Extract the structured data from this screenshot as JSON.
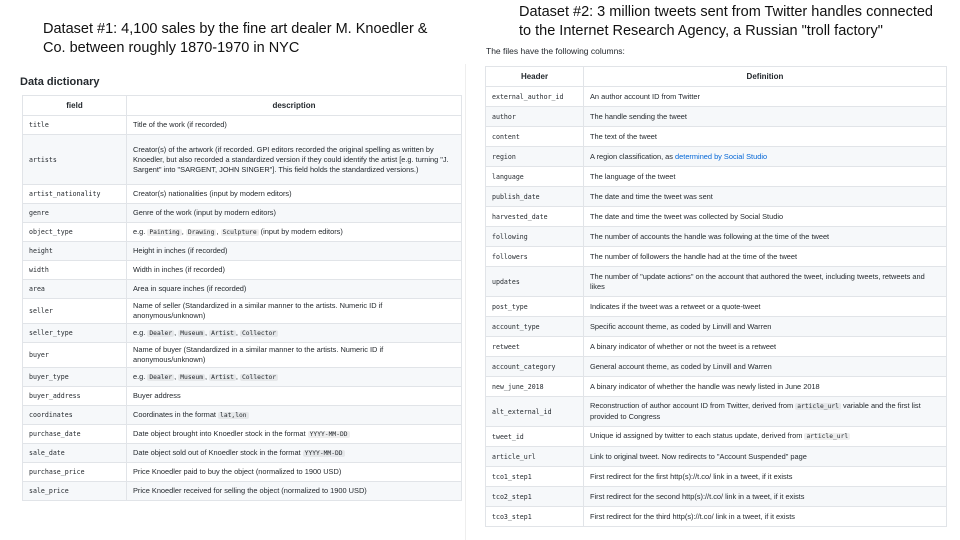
{
  "captions": {
    "dataset1": "Dataset #1: 4,100 sales by the fine art dealer M. Knoedler & Co. between roughly 1870-1970 in NYC",
    "dataset2": "Dataset #2: 3 million tweets sent from Twitter handles connected to the Internet Research Agency, a Russian \"troll factory\""
  },
  "left": {
    "heading": "Data dictionary",
    "columns": [
      "field",
      "description"
    ],
    "rows": [
      {
        "field": "title",
        "parts": [
          {
            "t": "Title of the work (if recorded)"
          }
        ]
      },
      {
        "field": "artists",
        "parts": [
          {
            "t": "Creator(s) of the artwork (if recorded. GPI editors recorded the original spelling as written by Knoedler, but also recorded a standardized version if they could identify the artist [e.g. turning \"J. Sargent\" into \"SARGENT, JOHN SINGER\"]. This field holds the standardized versions.)"
          }
        ]
      },
      {
        "field": "artist_nationality",
        "parts": [
          {
            "t": "Creator(s) nationalities (input by modern editors)"
          }
        ]
      },
      {
        "field": "genre",
        "parts": [
          {
            "t": "Genre of the work (input by modern editors)"
          }
        ]
      },
      {
        "field": "object_type",
        "parts": [
          {
            "t": "e.g. "
          },
          {
            "c": "Painting"
          },
          {
            "t": ", "
          },
          {
            "c": "Drawing"
          },
          {
            "t": ", "
          },
          {
            "c": "Sculpture"
          },
          {
            "t": " (input by modern editors)"
          }
        ]
      },
      {
        "field": "height",
        "parts": [
          {
            "t": "Height in inches (if recorded)"
          }
        ]
      },
      {
        "field": "width",
        "parts": [
          {
            "t": "Width in inches (if recorded)"
          }
        ]
      },
      {
        "field": "area",
        "parts": [
          {
            "t": "Area in square inches (if recorded)"
          }
        ]
      },
      {
        "field": "seller",
        "parts": [
          {
            "t": "Name of seller (Standardized in a similar manner to the artists. Numeric ID if anonymous/unknown)"
          }
        ]
      },
      {
        "field": "seller_type",
        "parts": [
          {
            "t": "e.g. "
          },
          {
            "c": "Dealer"
          },
          {
            "t": ", "
          },
          {
            "c": "Museum"
          },
          {
            "t": ", "
          },
          {
            "c": "Artist"
          },
          {
            "t": ", "
          },
          {
            "c": "Collector"
          }
        ]
      },
      {
        "field": "buyer",
        "parts": [
          {
            "t": "Name of buyer (Standardized in a similar manner to the artists. Numeric ID if anonymous/unknown)"
          }
        ]
      },
      {
        "field": "buyer_type",
        "parts": [
          {
            "t": "e.g. "
          },
          {
            "c": "Dealer"
          },
          {
            "t": ", "
          },
          {
            "c": "Museum"
          },
          {
            "t": ", "
          },
          {
            "c": "Artist"
          },
          {
            "t": ", "
          },
          {
            "c": "Collector"
          }
        ]
      },
      {
        "field": "buyer_address",
        "parts": [
          {
            "t": "Buyer address"
          }
        ]
      },
      {
        "field": "coordinates",
        "parts": [
          {
            "t": "Coordinates in the format "
          },
          {
            "c": "lat,lon"
          }
        ]
      },
      {
        "field": "purchase_date",
        "parts": [
          {
            "t": "Date object brought into Knoedler stock in the format "
          },
          {
            "c": "YYYY-MM-DD"
          }
        ]
      },
      {
        "field": "sale_date",
        "parts": [
          {
            "t": "Date object sold out of Knoedler stock in the format "
          },
          {
            "c": "YYYY-MM-DD"
          }
        ]
      },
      {
        "field": "purchase_price",
        "parts": [
          {
            "t": "Price Knoedler paid to buy the object (normalized to 1900 USD)"
          }
        ]
      },
      {
        "field": "sale_price",
        "parts": [
          {
            "t": "Price Knoedler received for selling the object (normalized to 1900 USD)"
          }
        ]
      }
    ]
  },
  "right": {
    "intro": "The files have the following columns:",
    "columns": [
      "Header",
      "Definition"
    ],
    "rows": [
      {
        "field": "external_author_id",
        "parts": [
          {
            "t": "An author account ID from Twitter"
          }
        ]
      },
      {
        "field": "author",
        "parts": [
          {
            "t": "The handle sending the tweet"
          }
        ]
      },
      {
        "field": "content",
        "parts": [
          {
            "t": "The text of the tweet"
          }
        ]
      },
      {
        "field": "region",
        "parts": [
          {
            "t": "A region classification, as "
          },
          {
            "a": "determined by Social Studio"
          }
        ]
      },
      {
        "field": "language",
        "parts": [
          {
            "t": "The language of the tweet"
          }
        ]
      },
      {
        "field": "publish_date",
        "parts": [
          {
            "t": "The date and time the tweet was sent"
          }
        ]
      },
      {
        "field": "harvested_date",
        "parts": [
          {
            "t": "The date and time the tweet was collected by Social Studio"
          }
        ]
      },
      {
        "field": "following",
        "parts": [
          {
            "t": "The number of accounts the handle was following at the time of the tweet"
          }
        ]
      },
      {
        "field": "followers",
        "parts": [
          {
            "t": "The number of followers the handle had at the time of the tweet"
          }
        ]
      },
      {
        "field": "updates",
        "parts": [
          {
            "t": "The number of \"update actions\" on the account that authored the tweet, including tweets, retweets and likes"
          }
        ]
      },
      {
        "field": "post_type",
        "parts": [
          {
            "t": "Indicates if the tweet was a retweet or a quote-tweet"
          }
        ]
      },
      {
        "field": "account_type",
        "parts": [
          {
            "t": "Specific account theme, as coded by Linvill and Warren"
          }
        ]
      },
      {
        "field": "retweet",
        "parts": [
          {
            "t": "A binary indicator of whether or not the tweet is a retweet"
          }
        ]
      },
      {
        "field": "account_category",
        "parts": [
          {
            "t": "General account theme, as coded by Linvill and Warren"
          }
        ]
      },
      {
        "field": "new_june_2018",
        "parts": [
          {
            "t": "A binary indicator of whether the handle was newly listed in June 2018"
          }
        ]
      },
      {
        "field": "alt_external_id",
        "parts": [
          {
            "t": "Reconstruction of author account ID from Twitter, derived from "
          },
          {
            "c": "article_url"
          },
          {
            "t": " variable and the first list provided to Congress"
          }
        ]
      },
      {
        "field": "tweet_id",
        "parts": [
          {
            "t": "Unique id assigned by twitter to each status update, derived from "
          },
          {
            "c": "article_url"
          }
        ]
      },
      {
        "field": "article_url",
        "parts": [
          {
            "t": "Link to original tweet. Now redirects to \"Account Suspended\" page"
          }
        ]
      },
      {
        "field": "tco1_step1",
        "parts": [
          {
            "t": "First redirect for the first http(s)://t.co/ link in a tweet, if it exists"
          }
        ]
      },
      {
        "field": "tco2_step1",
        "parts": [
          {
            "t": "First redirect for the second http(s)://t.co/ link in a tweet, if it exists"
          }
        ]
      },
      {
        "field": "tco3_step1",
        "parts": [
          {
            "t": "First redirect for the third http(s)://t.co/ link in a tweet, if it exists"
          }
        ]
      }
    ]
  }
}
